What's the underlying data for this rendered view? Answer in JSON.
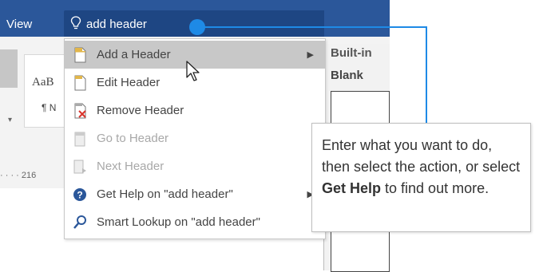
{
  "ribbon": {
    "view_tab": "View"
  },
  "search": {
    "value": "add header",
    "icon": "lightbulb-icon"
  },
  "background": {
    "style_sample": "AaB",
    "style_normal": "¶ N",
    "ruler_text": "· · · · 216"
  },
  "gallery": {
    "builtin": "Built-in",
    "blank": "Blank"
  },
  "menu": {
    "items": [
      {
        "label": "Add a Header",
        "icon": "header-page-icon",
        "enabled": true,
        "submenu": true,
        "highlight": true
      },
      {
        "label": "Edit Header",
        "icon": "edit-header-icon",
        "enabled": true,
        "submenu": false,
        "highlight": false
      },
      {
        "label": "Remove Header",
        "icon": "remove-header-icon",
        "enabled": true,
        "submenu": false,
        "highlight": false
      },
      {
        "label": "Go to Header",
        "icon": "go-to-header-icon",
        "enabled": false,
        "submenu": false,
        "highlight": false
      },
      {
        "label": "Next Header",
        "icon": "next-header-icon",
        "enabled": false,
        "submenu": false,
        "highlight": false
      },
      {
        "label": "Get Help on \"add header\"",
        "icon": "help-icon",
        "enabled": true,
        "submenu": true,
        "highlight": false
      },
      {
        "label": "Smart Lookup on \"add header\"",
        "icon": "smart-lookup-icon",
        "enabled": true,
        "submenu": false,
        "highlight": false
      }
    ]
  },
  "tooltip": {
    "part1": "Enter what you want to do, then select the action, or select ",
    "bold1": "Get Help",
    "part2": " to find out more."
  },
  "colors": {
    "ribbon": "#2b579a",
    "search_box": "#1e4683",
    "callout": "#1e8ae6",
    "highlight": "#c8c8c8"
  }
}
